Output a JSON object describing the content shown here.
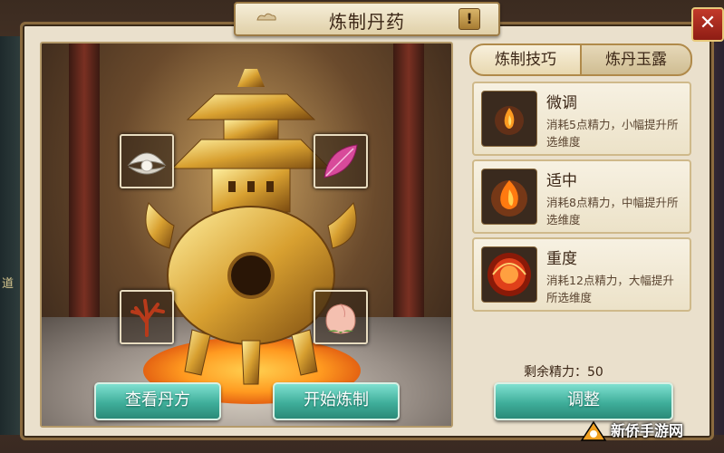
{
  "window": {
    "title": "炼制丹药",
    "hint_label": "!",
    "close_label": "✕"
  },
  "side": {
    "left_glyph": "道"
  },
  "scene": {
    "ingredients": [
      "pearl-shell",
      "pink-feather",
      "red-coral",
      "peach"
    ],
    "buttons": {
      "view_recipe": "查看丹方",
      "start_refine": "开始炼制"
    }
  },
  "tabs": [
    {
      "label": "炼制技巧",
      "active": true
    },
    {
      "label": "炼丹玉露",
      "active": false
    }
  ],
  "options": [
    {
      "name": "微调",
      "desc": "消耗5点精力，小幅提升所选维度",
      "icon": "small-flame-icon"
    },
    {
      "name": "适中",
      "desc": "消耗8点精力，中幅提升所选维度",
      "icon": "medium-flame-icon"
    },
    {
      "name": "重度",
      "desc": "消耗12点精力，大幅提升所选维度",
      "icon": "fire-orb-icon"
    }
  ],
  "stamina_text": "剩余精力：50",
  "adjust_button": "调整",
  "watermark": "新侨手游网",
  "colors": {
    "accent_green": "#3fae9a",
    "title_brown": "#3b2616",
    "close_red": "#c23a2a"
  }
}
